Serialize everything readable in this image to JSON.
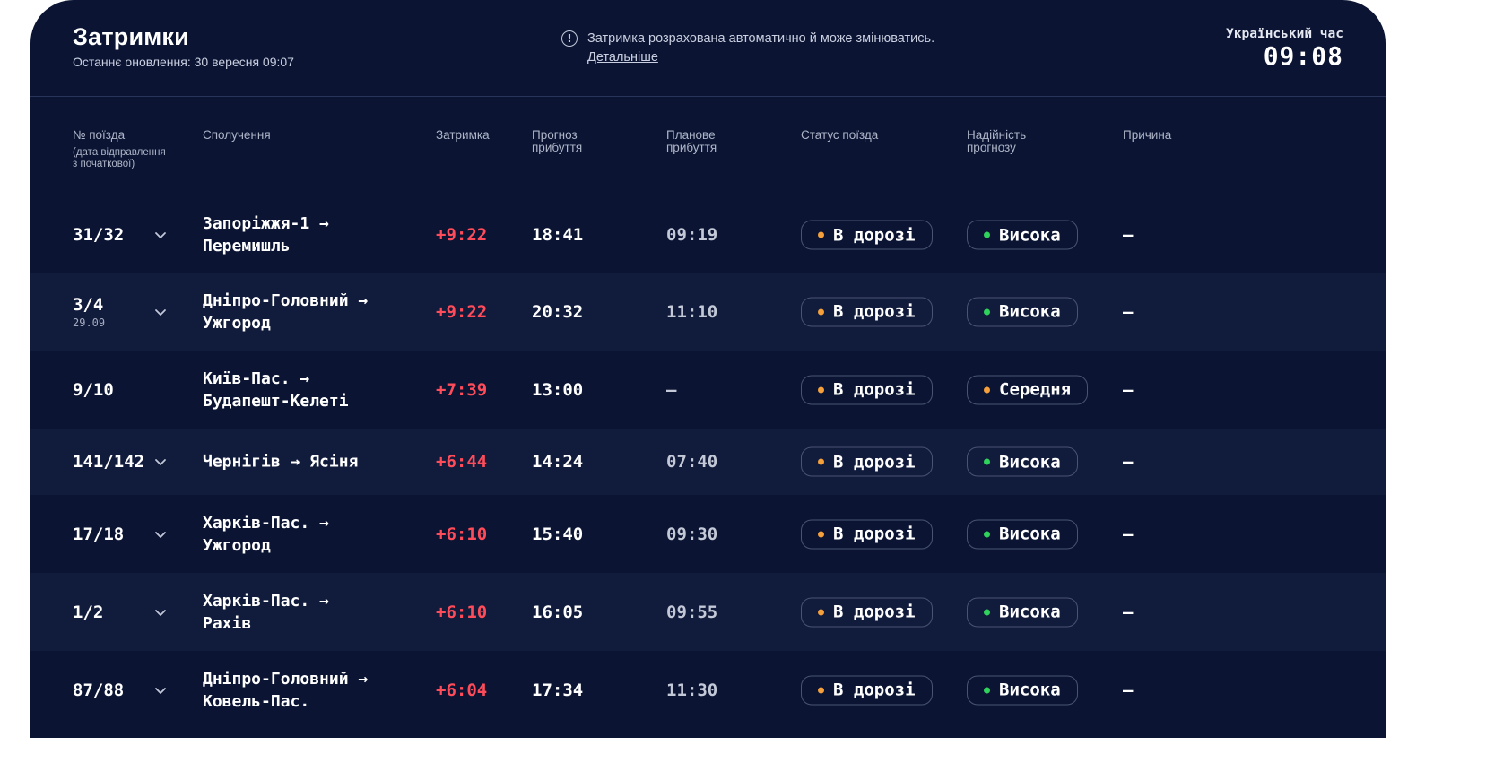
{
  "header": {
    "title": "Затримки",
    "updated": "Останнє оновлення: 30 вересня 09:07",
    "notice": "Затримка розрахована автоматично й може змінюватись.",
    "notice_link": "Детальніше",
    "info_icon": "!",
    "clock_label": "Український час",
    "clock_time": "09:08"
  },
  "columns": {
    "train": "№ поїзда",
    "train_sub": "(дата відправлення з початкової)",
    "route": "Сполучення",
    "delay": "Затримка",
    "forecast": "Прогноз прибуття",
    "planned": "Планове прибуття",
    "status": "Статус поїзда",
    "reliability": "Надійність прогнозу",
    "reason": "Причина"
  },
  "colors": {
    "orange": "#f5a03a",
    "green": "#2fd35c",
    "delay_red": "#ff4c5a"
  },
  "rows": [
    {
      "train": "31/32",
      "date": "",
      "expandable": true,
      "from": "Запоріжжя-1",
      "to": "Перемишль",
      "delay": "+9:22",
      "forecast": "18:41",
      "planned": "09:19",
      "status": "В дорозі",
      "status_color": "orange",
      "reliability": "Висока",
      "reliability_color": "green",
      "reason": "—"
    },
    {
      "train": "3/4",
      "date": "29.09",
      "expandable": true,
      "from": "Дніпро-Головний",
      "to": "Ужгород",
      "delay": "+9:22",
      "forecast": "20:32",
      "planned": "11:10",
      "status": "В дорозі",
      "status_color": "orange",
      "reliability": "Висока",
      "reliability_color": "green",
      "reason": "—"
    },
    {
      "train": "9/10",
      "date": "",
      "expandable": false,
      "from": "Київ-Пас.",
      "to": "Будапешт-Келеті",
      "delay": "+7:39",
      "forecast": "13:00",
      "planned": "—",
      "status": "В дорозі",
      "status_color": "orange",
      "reliability": "Середня",
      "reliability_color": "orange",
      "reason": "—"
    },
    {
      "train": "141/142",
      "date": "",
      "expandable": true,
      "from": "Чернігів",
      "to": "Ясіня",
      "oneline": true,
      "delay": "+6:44",
      "forecast": "14:24",
      "planned": "07:40",
      "status": "В дорозі",
      "status_color": "orange",
      "reliability": "Висока",
      "reliability_color": "green",
      "reason": "—"
    },
    {
      "train": "17/18",
      "date": "",
      "expandable": true,
      "from": "Харків-Пас.",
      "to": "Ужгород",
      "delay": "+6:10",
      "forecast": "15:40",
      "planned": "09:30",
      "status": "В дорозі",
      "status_color": "orange",
      "reliability": "Висока",
      "reliability_color": "green",
      "reason": "—"
    },
    {
      "train": "1/2",
      "date": "",
      "expandable": true,
      "from": "Харків-Пас.",
      "to": "Рахів",
      "delay": "+6:10",
      "forecast": "16:05",
      "planned": "09:55",
      "status": "В дорозі",
      "status_color": "orange",
      "reliability": "Висока",
      "reliability_color": "green",
      "reason": "—"
    },
    {
      "train": "87/88",
      "date": "",
      "expandable": true,
      "from": "Дніпро-Головний",
      "to": "Ковель-Пас.",
      "delay": "+6:04",
      "forecast": "17:34",
      "planned": "11:30",
      "status": "В дорозі",
      "status_color": "orange",
      "reliability": "Висока",
      "reliability_color": "green",
      "reason": "—"
    }
  ]
}
